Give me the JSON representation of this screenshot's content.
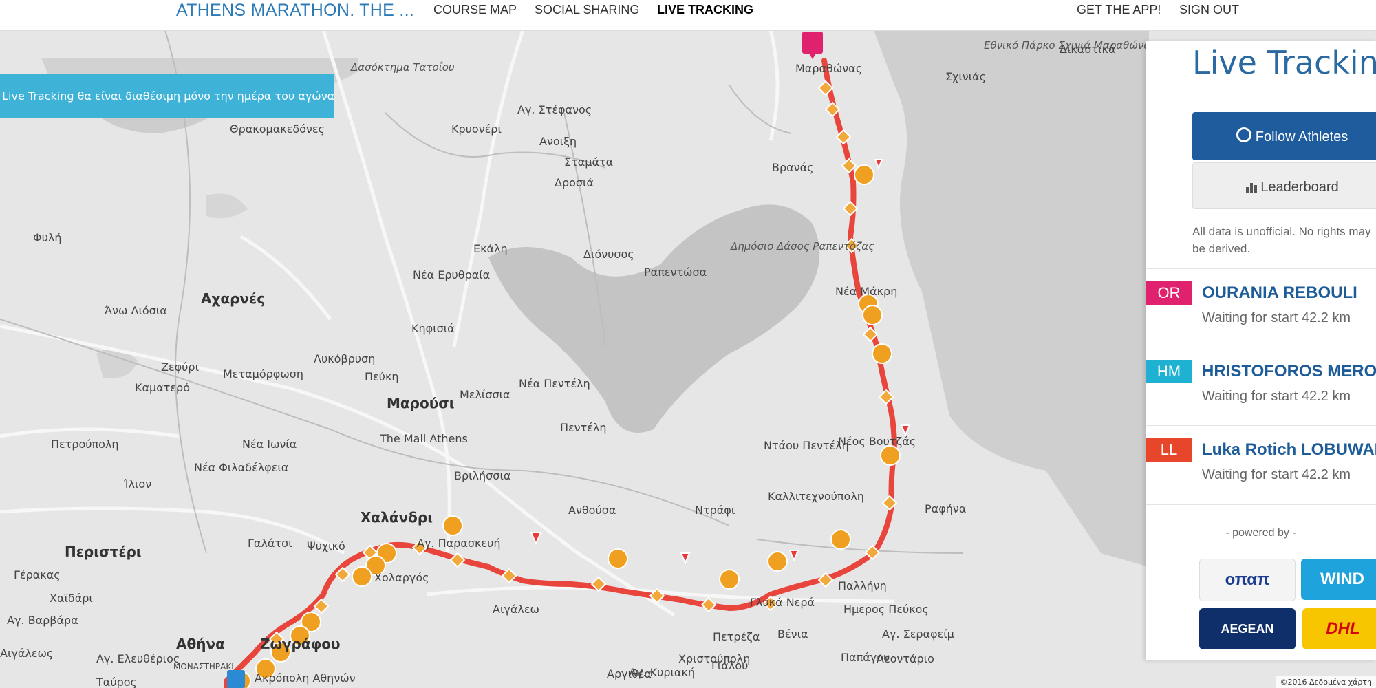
{
  "header": {
    "brand": "ATHENS MARATHON. THE ...",
    "nav": [
      "COURSE MAP",
      "SOCIAL SHARING",
      "LIVE TRACKING"
    ],
    "right_nav": [
      "GET THE APP!",
      "SIGN OUT"
    ],
    "active_nav": "LIVE TRACKING"
  },
  "banner": {
    "text": "Η Live Tracking θα είναι διαθέσιμη μόνο την ημέρα του αγώνα."
  },
  "map": {
    "places": [
      "Μαραθώνας",
      "Εθνικό Πάρκο Σχινιά Μαραθώνα",
      "Δικαστικά",
      "Σχινιάς",
      "Δασόκτημα Τατοΐου",
      "Αγ. Στέφανος",
      "Θρακομακεδόνες",
      "Κρυονέρι",
      "Ανοιξη",
      "Σταμάτα",
      "Δροσιά",
      "Βρανάς",
      "Νέα Μάκρη",
      "Δημόσιο Δάσος Ραπεντόζας",
      "Ραπεντώσα",
      "Διόνυσος",
      "Εκάλη",
      "Νέα Ερυθραία",
      "Αχαρνές",
      "Άνω Λιόσια",
      "Φυλή",
      "Κηφισιά",
      "Λυκόβρυση",
      "Πεύκη",
      "Μεταμόρφωση",
      "Ζεφύρι",
      "Καματερό",
      "Μαρούσι",
      "Μελίσσια",
      "Νέα Πεντέλη",
      "Πεντέλη",
      "The Mall Athens",
      "Πετρούπολη",
      "Νέα Ιωνία",
      "Νέα Φιλαδέλφεια",
      "Ίλιον",
      "Βριλήσσια",
      "Ντάου Πεντέλη",
      "Νέος Βουτζάς",
      "Καλλιτεχνούπολη",
      "Ραφήνα",
      "Χαλάνδρι",
      "Ανθούσα",
      "Ντράφι",
      "Περιστέρι",
      "Γαλάτσι",
      "Ψυχικό",
      "Χολαργός",
      "Αγ. Παρασκευή",
      "Γέρακας",
      "Χαϊδάρι",
      "Αιγάλεω",
      "Γλυκά Νερά",
      "Παλλήνη",
      "Ημερος Πεύκος",
      "Βένια",
      "Παπάγου",
      "Λεοντάριο",
      "Γιαλού",
      "Πετρέζα",
      "Αγ. Κυριακή",
      "Αθήνα",
      "Ζωγράφου",
      "Χριστούπολη",
      "Αγ. Σεραφείμ",
      "Αργιθέα",
      "Αγ. Βαρβάρα",
      "Αιγάλεως",
      "Αγ. Ελευθέριος",
      "Ακρόπολη Αθηνών",
      "Ταύρος",
      "ΜΟΝΑΣΤΗΡΑΚΙ"
    ],
    "copyright": "©2016 Δεδομένα χάρτη"
  },
  "panel": {
    "title": "Live Tracking",
    "follow_label": "Follow Athletes",
    "leaderboard_label": "Leaderboard",
    "disclaimer": "All data is unofficial. No rights may be derived.",
    "athletes": [
      {
        "initials": "OR",
        "name": "OURANIA REBOULI",
        "status": "Waiting for start 42.2 km",
        "color": "#e0226e"
      },
      {
        "initials": "HM",
        "name": "HRISTOFOROS MEROUSIS",
        "status": "Waiting for start 42.2 km",
        "color": "#1fb1d1"
      },
      {
        "initials": "LL",
        "name": "Luka Rotich LOBUWAN",
        "status": "Waiting for start 42.2 km",
        "color": "#e8462b"
      }
    ],
    "powered_by": "- powered by -",
    "sponsors": [
      "οπαπ",
      "WIND",
      "AEGEAN",
      "DHL"
    ]
  }
}
